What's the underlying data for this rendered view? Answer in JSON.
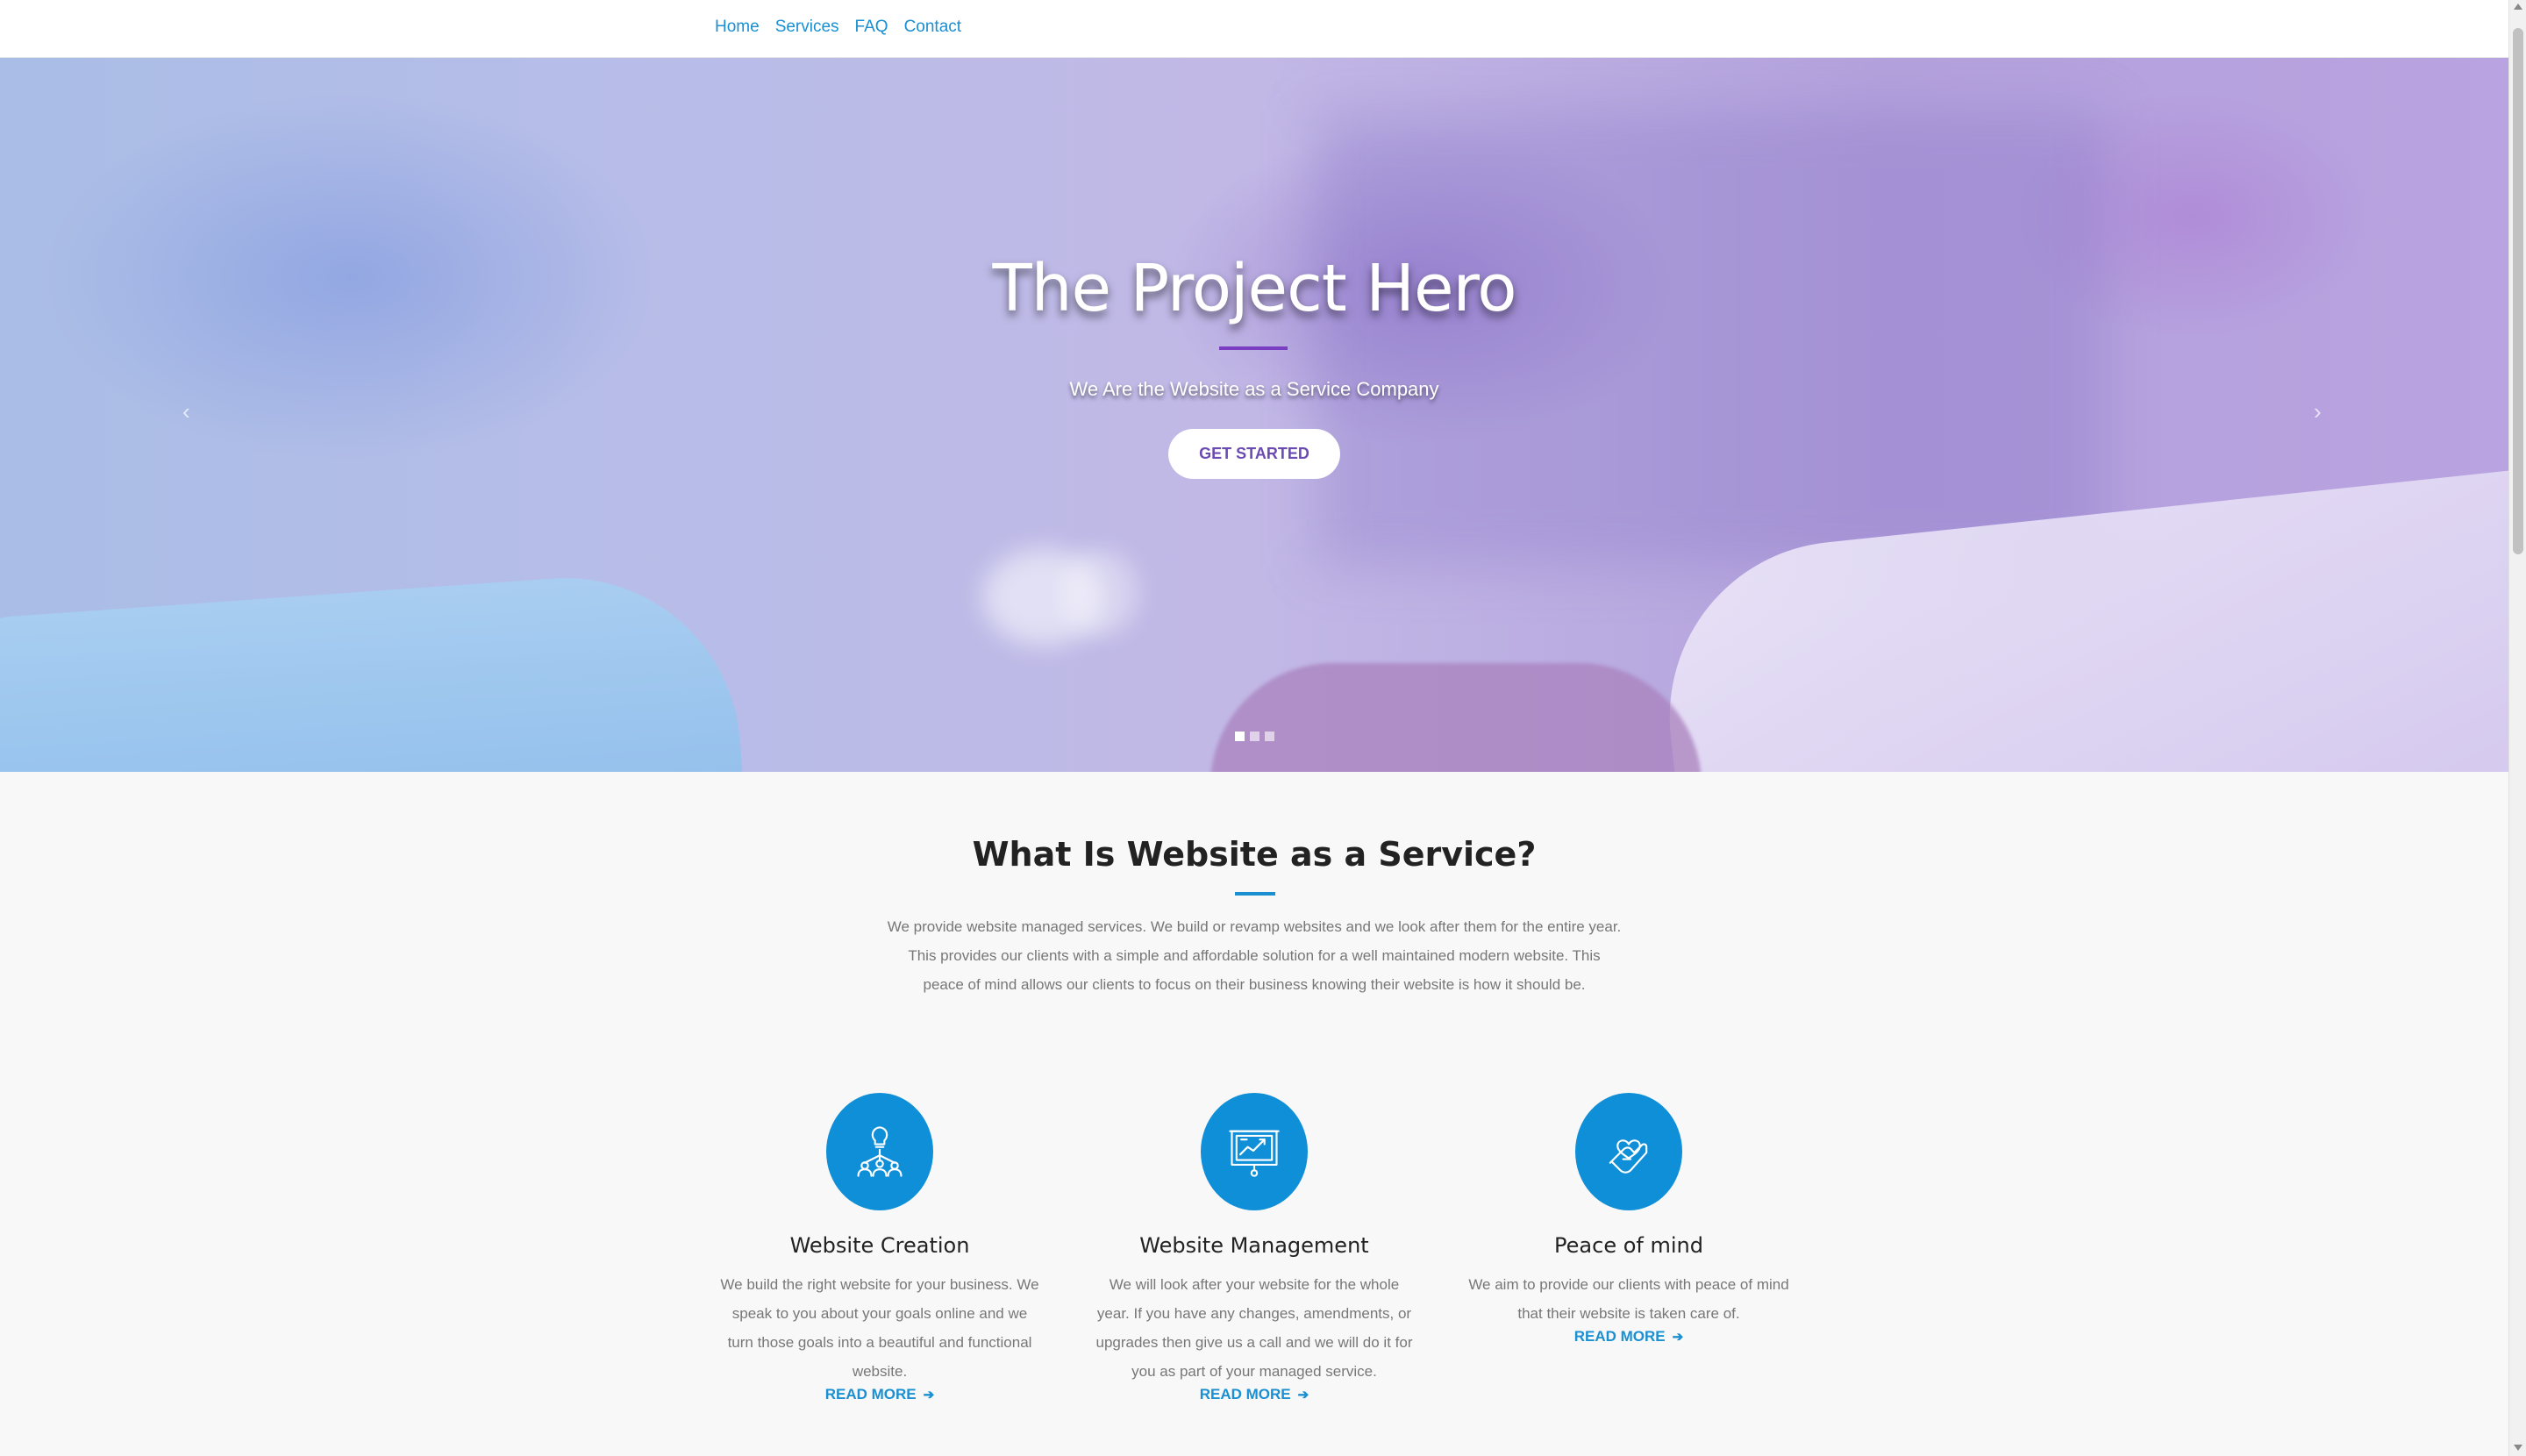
{
  "nav": {
    "items": [
      {
        "label": "Home"
      },
      {
        "label": "Services"
      },
      {
        "label": "FAQ"
      },
      {
        "label": "Contact"
      }
    ]
  },
  "hero": {
    "title": "The Project Hero",
    "subtitle": "We Are the Website as a Service Company",
    "button_label": "GET STARTED",
    "prev_icon": "‹",
    "next_icon": "›",
    "slide_count": 3,
    "active_slide": 1
  },
  "section": {
    "title": "What Is Website as a Service?",
    "text": "We provide website managed services. We build or revamp websites and we look after them for the entire year. This provides our clients with a simple and affordable solution for a well maintained modern website. This peace of mind allows our clients to focus on their business knowing their website is how it should be."
  },
  "features": [
    {
      "icon": "team-idea-icon",
      "title": "Website Creation",
      "text": "We build the right website for your business. We speak to you about your goals online and we turn those goals into a beautiful and functional website.",
      "link": "READ MORE"
    },
    {
      "icon": "presentation-chart-icon",
      "title": "Website Management",
      "text": "We will look after your website for the whole year. If you have any changes, amendments, or upgrades then give us a call and we will do it for you as part of your managed service.",
      "link": "READ MORE"
    },
    {
      "icon": "hand-heart-icon",
      "title": "Peace of mind",
      "text": "We aim to provide our clients with peace of mind that their website is taken care of.",
      "link": "READ MORE"
    }
  ],
  "colors": {
    "accent": "#1a8fd1",
    "hero_accent": "#7a3ec3",
    "icon_bg": "#0f8fd8"
  }
}
